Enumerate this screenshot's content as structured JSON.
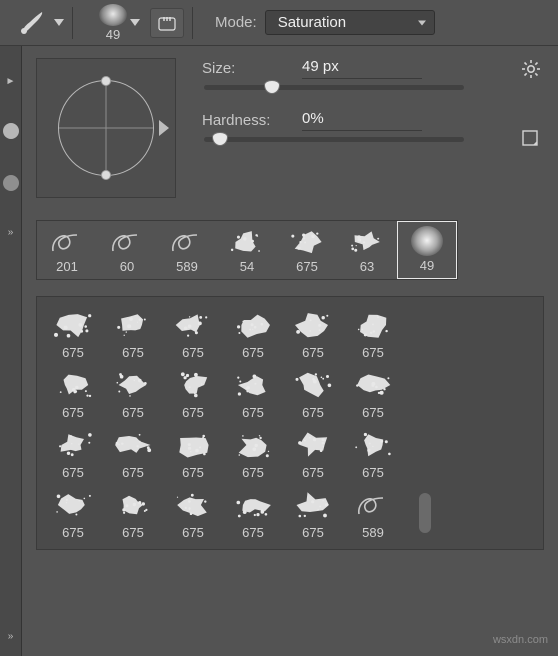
{
  "toolbar": {
    "brush_preview_value": "49",
    "mode_label": "Mode:",
    "mode_value": "Saturation"
  },
  "panel": {
    "size_label": "Size:",
    "size_value": "49 px",
    "size_thumb_pct": 26,
    "hardness_label": "Hardness:",
    "hardness_value": "0%",
    "hardness_thumb_pct": 6
  },
  "recent_brushes": [
    {
      "label": "201",
      "kind": "loop",
      "selected": false
    },
    {
      "label": "60",
      "kind": "loop",
      "selected": false
    },
    {
      "label": "589",
      "kind": "loop",
      "selected": false
    },
    {
      "label": "54",
      "kind": "splat",
      "seed": 1,
      "selected": false
    },
    {
      "label": "675",
      "kind": "splat",
      "seed": 2,
      "selected": false
    },
    {
      "label": "63",
      "kind": "splat",
      "seed": 3,
      "selected": false
    },
    {
      "label": "49",
      "kind": "soft",
      "selected": true
    }
  ],
  "library": [
    {
      "label": "675",
      "seed": 11
    },
    {
      "label": "675",
      "seed": 12
    },
    {
      "label": "675",
      "seed": 13
    },
    {
      "label": "675",
      "seed": 14
    },
    {
      "label": "675",
      "seed": 15
    },
    {
      "label": "675",
      "seed": 16
    },
    {
      "label": "675",
      "seed": 21
    },
    {
      "label": "675",
      "seed": 22
    },
    {
      "label": "675",
      "seed": 23
    },
    {
      "label": "675",
      "seed": 24
    },
    {
      "label": "675",
      "seed": 25
    },
    {
      "label": "675",
      "seed": 26
    },
    {
      "label": "675",
      "seed": 31
    },
    {
      "label": "675",
      "seed": 32
    },
    {
      "label": "675",
      "seed": 33
    },
    {
      "label": "675",
      "seed": 34
    },
    {
      "label": "675",
      "seed": 35
    },
    {
      "label": "675",
      "seed": 36
    },
    {
      "label": "675",
      "seed": 41
    },
    {
      "label": "675",
      "seed": 42
    },
    {
      "label": "675",
      "seed": 43
    },
    {
      "label": "675",
      "seed": 44
    },
    {
      "label": "675",
      "seed": 45
    },
    {
      "label": "589",
      "seed": 46,
      "kind": "loop"
    }
  ],
  "watermark": "wsxdn.com"
}
